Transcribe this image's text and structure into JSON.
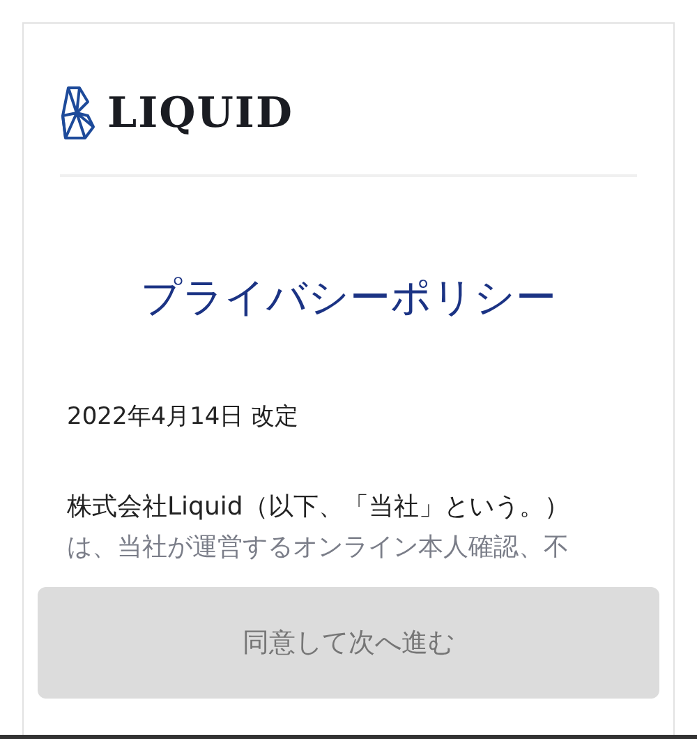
{
  "logo": {
    "text": "LIQUID"
  },
  "title": "プライバシーポリシー",
  "revised_date": "2022年4月14日 改定",
  "paragraph_lines": [
    "株式会社Liquid（以下、「当社」という。）",
    "は、当社が運営するオンライン本人確認、不"
  ],
  "agree_button": {
    "label": "同意して次へ進む",
    "disabled": true
  }
}
